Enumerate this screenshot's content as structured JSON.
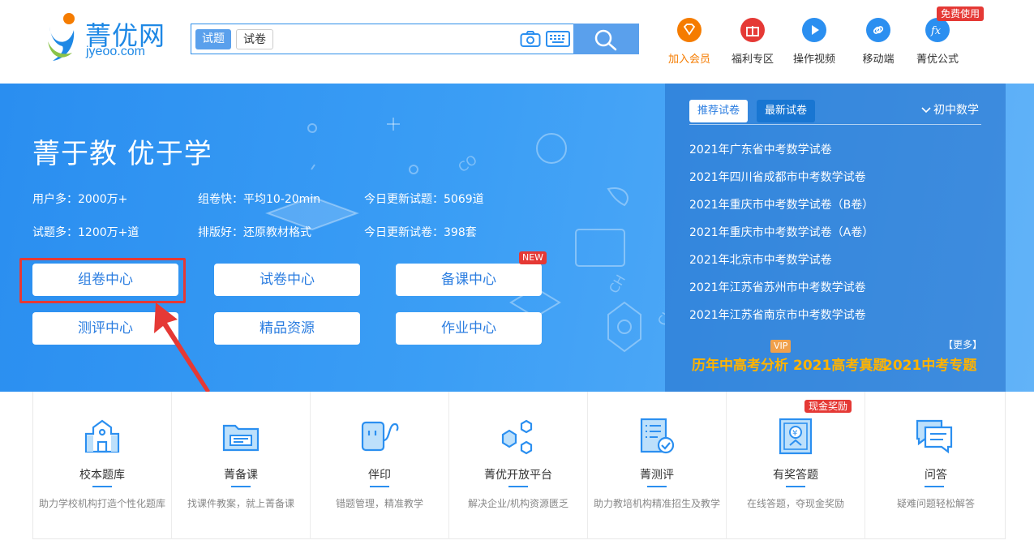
{
  "logo": {
    "cn": "菁优网",
    "en": "jyeoo.com"
  },
  "search": {
    "tab_active": "试题",
    "tab_inactive": "试卷",
    "placeholder": ""
  },
  "header_nav": [
    {
      "label": "加入会员",
      "icon": "diamond-icon",
      "color": "#f57c00"
    },
    {
      "label": "福利专区",
      "icon": "gift-icon",
      "color": "#e53935"
    },
    {
      "label": "操作视频",
      "icon": "play-icon",
      "color": "#2b8ff0"
    },
    {
      "label": "移动端",
      "icon": "link-icon",
      "color": "#2b8ff0"
    },
    {
      "label": "菁优公式",
      "icon": "formula-icon",
      "color": "#2b8ff0"
    }
  ],
  "free_badge": "免费使用",
  "banner": {
    "slogan": "菁于教 优于学",
    "stats": [
      "用户多：2000万+",
      "组卷快：平均10-20min",
      "今日更新试题：5069道",
      "试题多：1200万+道",
      "排版好：还原教材格式",
      "今日更新试卷：398套"
    ],
    "buttons": [
      "组卷中心",
      "试卷中心",
      "备课中心",
      "测评中心",
      "精品资源",
      "作业中心"
    ],
    "new_badge": "NEW"
  },
  "side": {
    "tab1": "推荐试卷",
    "tab2": "最新试卷",
    "grade": "初中数学",
    "papers": [
      "2021年广东省中考数学试卷",
      "2021年四川省成都市中考数学试卷",
      "2021年重庆市中考数学试卷（B卷）",
      "2021年重庆市中考数学试卷（A卷）",
      "2021年北京市中考数学试卷",
      "2021年江苏省苏州市中考数学试卷",
      "2021年江苏省南京市中考数学试卷"
    ],
    "more": "【更多】",
    "vip": "VIP",
    "promos": [
      "历年中高考分析",
      "2021高考真题",
      "2021中考专题"
    ]
  },
  "cards": [
    {
      "title": "校本题库",
      "desc": "助力学校机构打造个性化题库",
      "icon": "school-icon"
    },
    {
      "title": "菁备课",
      "desc": "找课件教案，就上菁备课",
      "icon": "folder-icon"
    },
    {
      "title": "伴印",
      "desc": "错题管理，精准教学",
      "icon": "printer-icon"
    },
    {
      "title": "菁优开放平台",
      "desc": "解决企业/机构资源匮乏",
      "icon": "hexagon-icon"
    },
    {
      "title": "菁测评",
      "desc": "助力教培机构精准招生及教学",
      "icon": "checklist-icon"
    },
    {
      "title": "有奖答题",
      "desc": "在线答题，夺现金奖励",
      "icon": "certificate-icon"
    },
    {
      "title": "问答",
      "desc": "疑难问题轻松解答",
      "icon": "chat-icon"
    }
  ],
  "cash_badge": "现金奖励",
  "colors": {
    "primary": "#2b8ff0",
    "accent": "#f57c00",
    "badge": "#e53935"
  }
}
